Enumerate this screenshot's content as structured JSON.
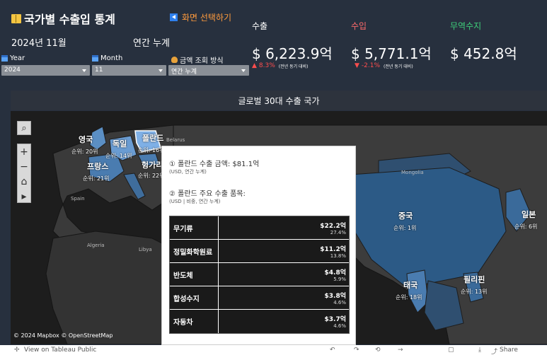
{
  "header": {
    "title": "국가별 수출입 통계",
    "screen_select": "화면 선택하기",
    "date": "2024년 11월",
    "mode": "연간 누계"
  },
  "filters": {
    "year_label": "Year",
    "year_value": "2024",
    "month_label": "Month",
    "month_value": "11",
    "method_label": "금액 조회 방식",
    "method_value": "연간 누계"
  },
  "kpis": {
    "export_label": "수출",
    "export_value": "$ 6,223.9억",
    "export_change": "8.3%",
    "export_change_note": "(전년 동기 대비)",
    "import_label": "수입",
    "import_value": "$ 5,771.1억",
    "import_change": "-2.1%",
    "import_change_note": "(전년 동기 대비)",
    "balance_label": "무역수지",
    "balance_value": "$ 452.8억",
    "colors": {
      "export": "#ffffff",
      "import": "#ff6b6b",
      "balance": "#3ecf7a",
      "down": "#ff4d4d"
    }
  },
  "map": {
    "title": "글로벌 30대 수출 국가",
    "attribution": "© 2024 Mapbox © OpenStreetMap",
    "countries": [
      {
        "name": "영국",
        "rank": "순위: 20위"
      },
      {
        "name": "독일",
        "rank": "순위: 14위"
      },
      {
        "name": "폴란드",
        "rank": "순위: 16위"
      },
      {
        "name": "프랑스",
        "rank": "순위: 21위"
      },
      {
        "name": "헝가리",
        "rank": "순위: 22위"
      },
      {
        "name": "중국",
        "rank": "순위: 1위"
      },
      {
        "name": "일본",
        "rank": "순위: 6위"
      },
      {
        "name": "태국",
        "rank": "순위: 18위"
      },
      {
        "name": "필리핀",
        "rank": "순위: 13위"
      }
    ],
    "base_labels": [
      "Belarus",
      "Spain",
      "Algeria",
      "Libya",
      "Mongolia"
    ]
  },
  "tooltip": {
    "line1": "① 폴란드 수출 금액: $81.1억",
    "line1_sub": "(USD, 연간 누계)",
    "line2": "② 폴란드 주요 수출 품목:",
    "line2_sub": "(USD | 비중, 연간 누계)",
    "rows": [
      {
        "item": "무기류",
        "amount": "$22.2억",
        "share": "27.4%"
      },
      {
        "item": "정밀화학원료",
        "amount": "$11.2억",
        "share": "13.8%"
      },
      {
        "item": "반도체",
        "amount": "$4.8억",
        "share": "5.9%"
      },
      {
        "item": "합성수지",
        "amount": "$3.8억",
        "share": "4.6%"
      },
      {
        "item": "자동차",
        "amount": "$3.7억",
        "share": "4.6%"
      }
    ]
  },
  "footer": {
    "view_on": "View on Tableau Public",
    "share": "Share"
  }
}
